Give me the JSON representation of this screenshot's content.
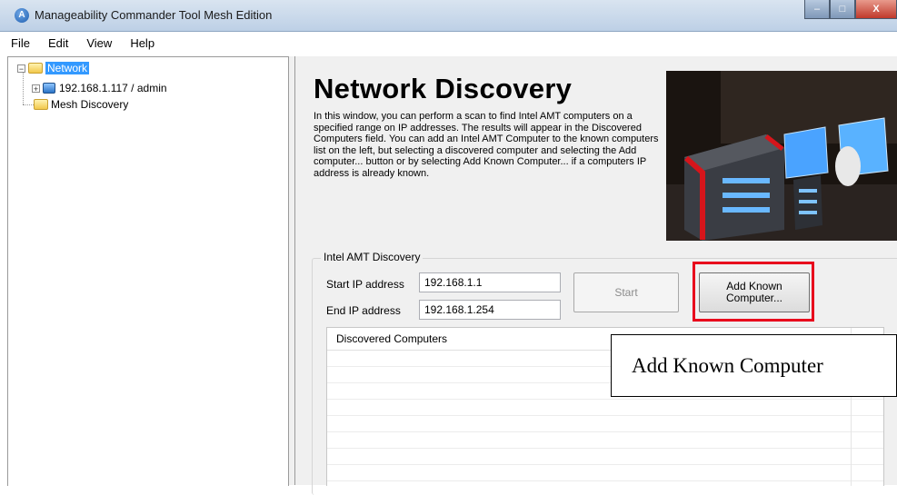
{
  "window": {
    "title": "Manageability Commander Tool Mesh Edition",
    "app_icon_glyph": "A",
    "minimize_glyph": "–",
    "maximize_glyph": "□",
    "close_glyph": "X"
  },
  "menu": [
    "File",
    "Edit",
    "View",
    "Help"
  ],
  "tree": {
    "network": "Network",
    "computer": "192.168.1.117 / admin",
    "mesh": "Mesh Discovery",
    "expand_glyph": "−",
    "collapse_glyph": "+"
  },
  "main": {
    "title": "Network Discovery",
    "description": "In this window, you can perform a scan to find Intel AMT computers on a specified range on IP addresses. The results will appear in the Discovered Computers field. You can add an Intel AMT Computer to the known computers list on the left, but selecting a discovered computer and selecting the Add computer... button or by selecting Add Known Computer... if a computers IP address is already known."
  },
  "discovery": {
    "group_title": "Intel AMT Discovery",
    "start_label": "Start IP address",
    "start_value": "192.168.1.1",
    "end_label": "End IP address",
    "end_value": "192.168.1.254",
    "start_button": "Start",
    "add_button_line1": "Add Known",
    "add_button_line2": "Computer...",
    "list_header": "Discovered Computers"
  },
  "annotation": "Add Known Computer",
  "colors": {
    "selection": "#3399ff",
    "highlight_border": "#e8001c",
    "panel_bg": "#f0f0f0"
  }
}
